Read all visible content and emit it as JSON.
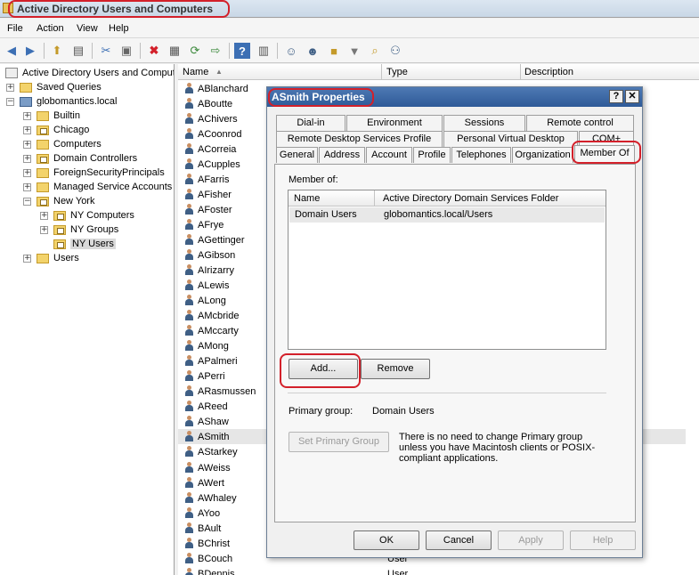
{
  "window": {
    "title": "Active Directory Users and Computers"
  },
  "menu": [
    "File",
    "Action",
    "View",
    "Help"
  ],
  "toolbar_icons": [
    "back-icon",
    "forward-icon",
    "up-icon",
    "show-hide-tree-icon",
    "cut-icon",
    "paste-icon",
    "delete-icon",
    "properties-icon",
    "refresh-icon",
    "export-icon",
    "help-icon",
    "console-icon",
    "new-user-icon",
    "new-group-icon",
    "new-ou-icon",
    "filter-icon",
    "find-icon",
    "add-to-group-icon"
  ],
  "tree": {
    "root": "Active Directory Users and Comput",
    "saved_queries": "Saved Queries",
    "domain": "globomantics.local",
    "children": [
      "Builtin",
      "Chicago",
      "Computers",
      "Domain Controllers",
      "ForeignSecurityPrincipals",
      "Managed Service Accounts",
      "New York"
    ],
    "ny_children": [
      "NY Computers",
      "NY Groups",
      "NY Users"
    ],
    "users": "Users"
  },
  "list": {
    "columns": [
      "Name",
      "Type",
      "Description"
    ],
    "users": [
      "ABlanchard",
      "ABoutte",
      "AChivers",
      "ACoonrod",
      "ACorreia",
      "ACupples",
      "AFarris",
      "AFisher",
      "AFoster",
      "AFrye",
      "AGettinger",
      "AGibson",
      "AIrizarry",
      "ALewis",
      "ALong",
      "AMcbride",
      "AMccarty",
      "AMong",
      "APalmeri",
      "APerri",
      "ARasmussen",
      "AReed",
      "AShaw",
      "ASmith",
      "AStarkey",
      "AWeiss",
      "AWert",
      "AWhaley",
      "AYoo",
      "BAult",
      "BChrist",
      "BCouch",
      "BDennis"
    ],
    "visible_types": {
      "BCouch": "User",
      "BDennis": "User"
    }
  },
  "dialog": {
    "title": "ASmith Properties",
    "help_btn": "?",
    "close_btn": "✕",
    "tabs_row1": [
      "Dial-in",
      "Environment",
      "Sessions",
      "Remote control"
    ],
    "tabs_row2": [
      "Remote Desktop Services Profile",
      "Personal Virtual Desktop",
      "COM+"
    ],
    "tabs_row3": [
      "General",
      "Address",
      "Account",
      "Profile",
      "Telephones",
      "Organization",
      "Member Of"
    ],
    "member_of_label": "Member of:",
    "table_headers": [
      "Name",
      "Active Directory Domain Services Folder"
    ],
    "table_rows": [
      {
        "name": "Domain Users",
        "folder": "globomantics.local/Users"
      }
    ],
    "add_btn": "Add...",
    "remove_btn": "Remove",
    "primary_group_label": "Primary group:",
    "primary_group_value": "Domain Users",
    "set_primary_btn": "Set Primary Group",
    "info_text": "There is no need to change Primary group unless you have Macintosh clients or POSIX-compliant applications.",
    "ok_btn": "OK",
    "cancel_btn": "Cancel",
    "apply_btn": "Apply",
    "help_bottom_btn": "Help"
  },
  "colors": {
    "highlight_ring": "#d3202a",
    "dialog_title": "#2e5a98"
  }
}
